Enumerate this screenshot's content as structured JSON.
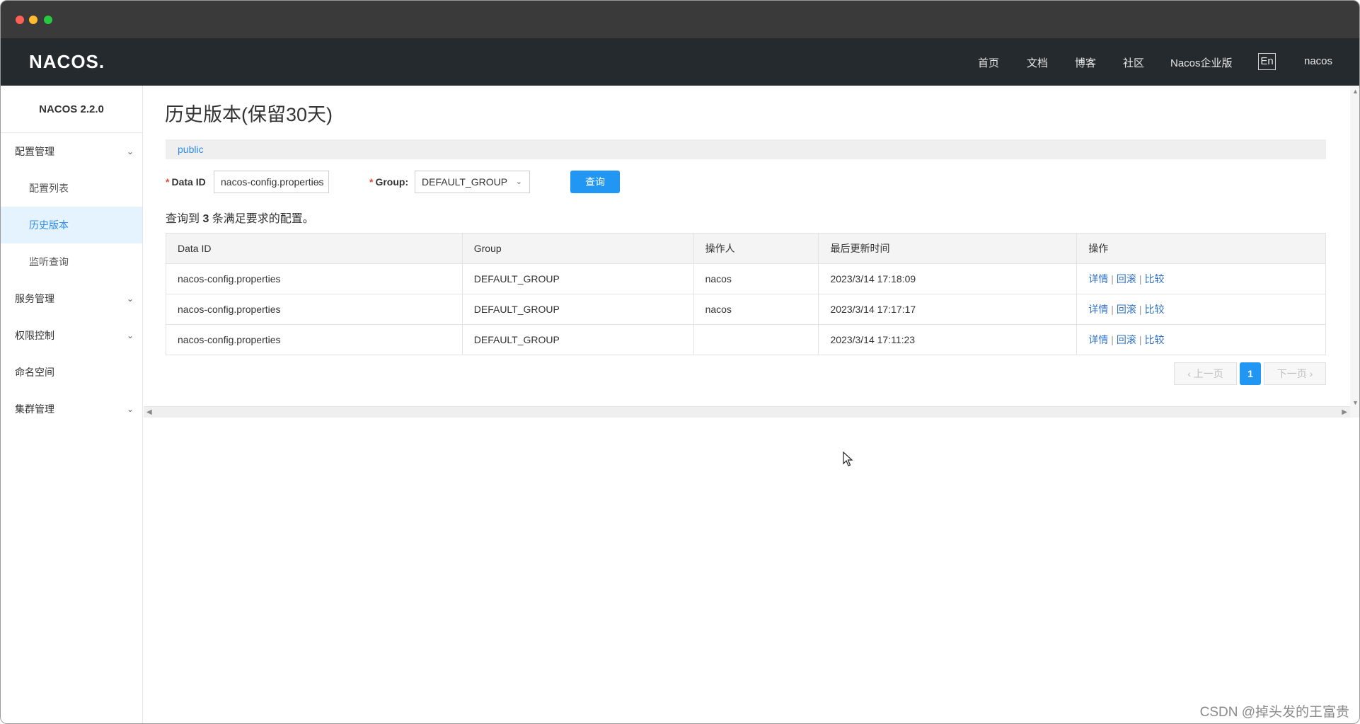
{
  "header": {
    "logo": "NACOS.",
    "nav": [
      "首页",
      "文档",
      "博客",
      "社区",
      "Nacos企业版"
    ],
    "lang": "En",
    "user": "nacos"
  },
  "sidebar": {
    "version": "NACOS 2.2.0",
    "config_group": "配置管理",
    "config_list": "配置列表",
    "history": "历史版本",
    "listen_query": "监听查询",
    "service": "服务管理",
    "auth": "权限控制",
    "namespace": "命名空间",
    "cluster": "集群管理"
  },
  "main": {
    "title": "历史版本(保留30天)",
    "namespace": "public",
    "form": {
      "data_id_label": "Data ID",
      "data_id_value": "nacos-config.properties",
      "group_label": "Group:",
      "group_value": "DEFAULT_GROUP",
      "query": "查询"
    },
    "result_prefix": "查询到 ",
    "result_count": "3",
    "result_suffix": " 条满足要求的配置。",
    "table": {
      "headers": [
        "Data ID",
        "Group",
        "操作人",
        "最后更新时间",
        "操作"
      ],
      "rows": [
        {
          "data_id": "nacos-config.properties",
          "group": "DEFAULT_GROUP",
          "operator": "nacos",
          "time": "2023/3/14 17:18:09"
        },
        {
          "data_id": "nacos-config.properties",
          "group": "DEFAULT_GROUP",
          "operator": "nacos",
          "time": "2023/3/14 17:17:17"
        },
        {
          "data_id": "nacos-config.properties",
          "group": "DEFAULT_GROUP",
          "operator": "",
          "time": "2023/3/14 17:11:23"
        }
      ],
      "actions": {
        "detail": "详情",
        "rollback": "回滚",
        "compare": "比较"
      }
    },
    "pager": {
      "prev": "上一页",
      "current": "1",
      "next": "下一页"
    }
  },
  "watermark": "CSDN @掉头发的王富贵",
  "colors": {
    "accent": "#2196f3",
    "nav_bg": "#252a2f",
    "link": "#2f72c7"
  }
}
